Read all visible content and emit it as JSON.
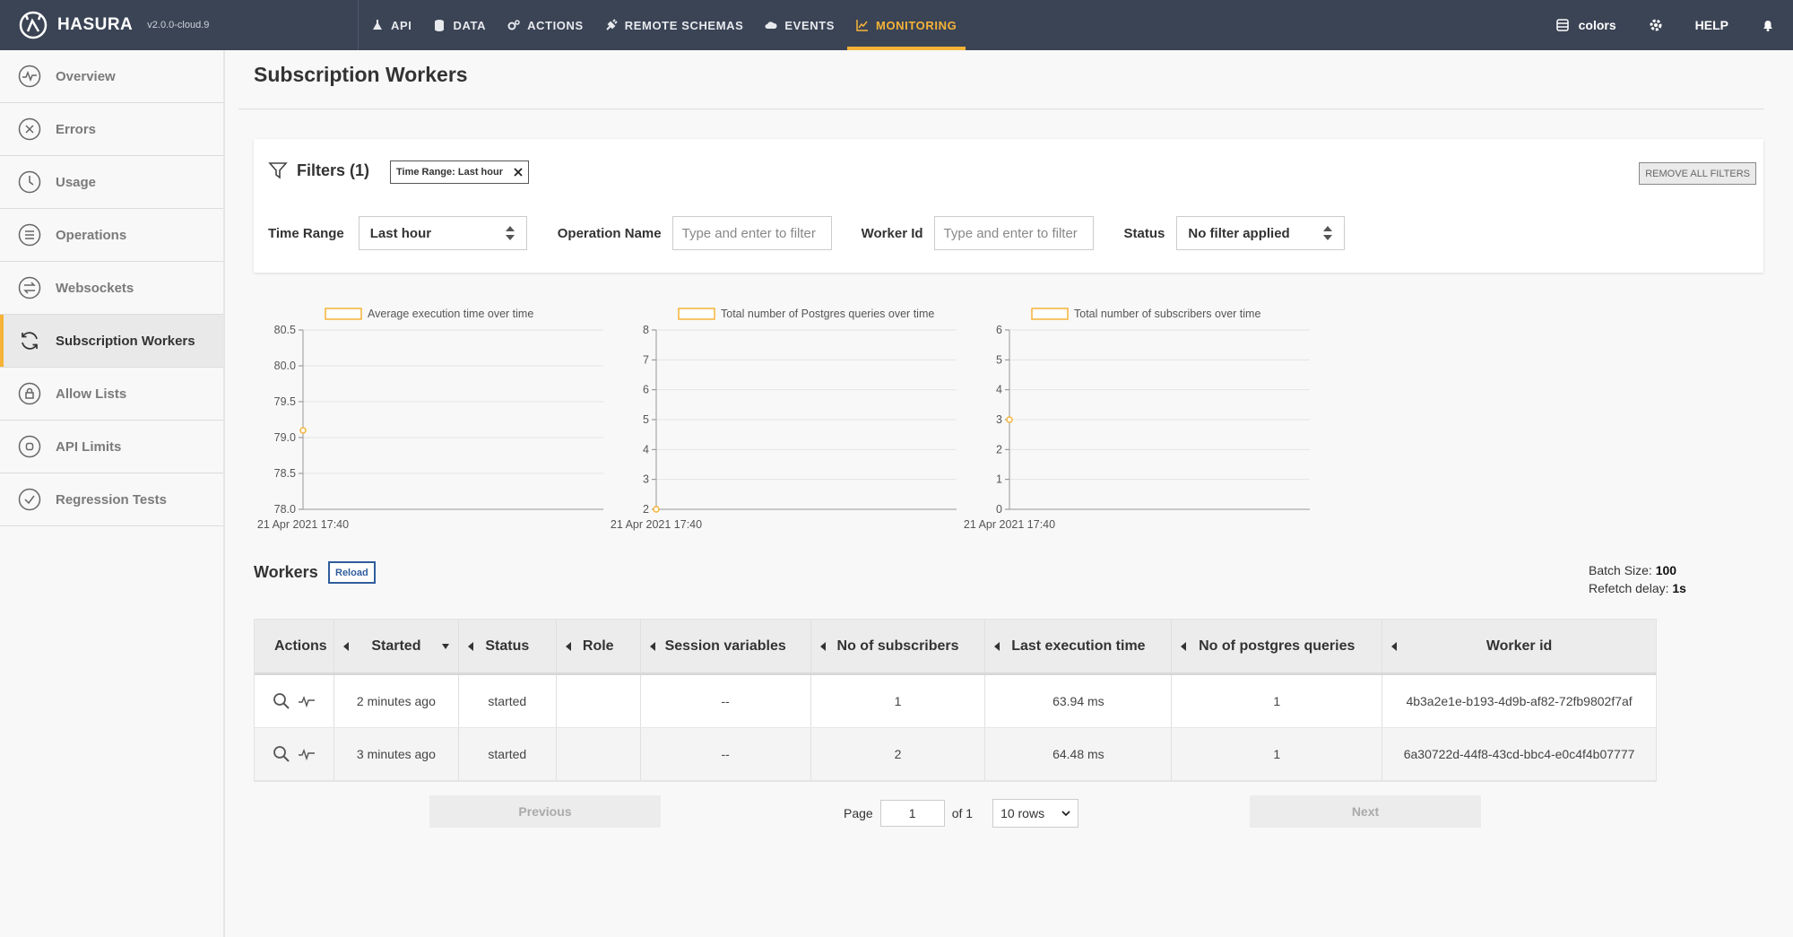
{
  "app": {
    "brand": "HASURA",
    "version": "v2.0.0-cloud.9"
  },
  "nav": {
    "items": [
      {
        "label": "API",
        "icon": "flask-icon"
      },
      {
        "label": "DATA",
        "icon": "database-icon"
      },
      {
        "label": "ACTIONS",
        "icon": "gears-icon"
      },
      {
        "label": "REMOTE SCHEMAS",
        "icon": "plug-icon"
      },
      {
        "label": "EVENTS",
        "icon": "cloud-icon"
      },
      {
        "label": "MONITORING",
        "icon": "chart-line-icon",
        "active": true
      }
    ],
    "right": {
      "colors_label": "colors",
      "help_label": "HELP"
    }
  },
  "sidebar": {
    "items": [
      {
        "label": "Overview",
        "icon": "pulse-icon"
      },
      {
        "label": "Errors",
        "icon": "x-circle-icon"
      },
      {
        "label": "Usage",
        "icon": "clock-icon"
      },
      {
        "label": "Operations",
        "icon": "list-icon"
      },
      {
        "label": "Websockets",
        "icon": "arrows-exchange-icon"
      },
      {
        "label": "Subscription Workers",
        "icon": "refresh-icon",
        "active": true
      },
      {
        "label": "Allow Lists",
        "icon": "lock-icon"
      },
      {
        "label": "API Limits",
        "icon": "stop-icon"
      },
      {
        "label": "Regression Tests",
        "icon": "check-circle-icon"
      }
    ]
  },
  "page": {
    "title": "Subscription Workers"
  },
  "filters": {
    "heading": "Filters (1)",
    "chip_label": "Time Range: Last hour",
    "remove_all": "REMOVE ALL FILTERS",
    "time_range_label": "Time Range",
    "time_range_value": "Last hour",
    "operation_name_label": "Operation Name",
    "operation_name_placeholder": "Type and enter to filter",
    "worker_id_label": "Worker Id",
    "worker_id_placeholder": "Type and enter to filter",
    "status_label": "Status",
    "status_value": "No filter applied"
  },
  "chart_data": [
    {
      "type": "line",
      "legend": "Average execution time over time",
      "x": [
        "21 Apr 2021 17:40"
      ],
      "y": [
        79.1
      ],
      "yticks": [
        "78.0",
        "78.5",
        "79.0",
        "79.5",
        "80.0",
        "80.5"
      ],
      "ylim": [
        78.0,
        80.5
      ],
      "grid": true,
      "color": "#f6b337"
    },
    {
      "type": "line",
      "legend": "Total number of Postgres queries over time",
      "x": [
        "21 Apr 2021 17:40"
      ],
      "y": [
        2
      ],
      "yticks": [
        "2",
        "3",
        "4",
        "5",
        "6",
        "7",
        "8"
      ],
      "ylim": [
        2,
        8
      ],
      "grid": true,
      "color": "#f6b337"
    },
    {
      "type": "line",
      "legend": "Total number of subscribers over time",
      "x": [
        "21 Apr 2021 17:40"
      ],
      "y": [
        3
      ],
      "yticks": [
        "0",
        "1",
        "2",
        "3",
        "4",
        "5",
        "6"
      ],
      "ylim": [
        0,
        6
      ],
      "grid": true,
      "color": "#f6b337"
    }
  ],
  "workers": {
    "title": "Workers",
    "reload_label": "Reload",
    "batch_size_label": "Batch Size:",
    "batch_size_value": "100",
    "refetch_label": "Refetch delay:",
    "refetch_value": "1s",
    "columns": [
      "Actions",
      "Started",
      "Status",
      "Role",
      "Session variables",
      "No of subscribers",
      "Last execution time",
      "No of postgres queries",
      "Worker id"
    ],
    "rows": [
      {
        "started": "2 minutes ago",
        "status": "started",
        "role": "",
        "session": "--",
        "subscribers": "1",
        "last_exec": "63.94 ms",
        "pg_queries": "1",
        "worker_id": "4b3a2e1e-b193-4d9b-af82-72fb9802f7af"
      },
      {
        "started": "3 minutes ago",
        "status": "started",
        "role": "",
        "session": "--",
        "subscribers": "2",
        "last_exec": "64.48 ms",
        "pg_queries": "1",
        "worker_id": "6a30722d-44f8-43cd-bbc4-e0c4f4b07777"
      }
    ]
  },
  "pagination": {
    "previous": "Previous",
    "next": "Next",
    "page_label": "Page",
    "page_value": "1",
    "of_label": "of 1",
    "rows_value": "10 rows"
  },
  "colors": {
    "accent": "#f6b337",
    "topbar": "#3b4455",
    "reload": "#2f5d9c"
  }
}
